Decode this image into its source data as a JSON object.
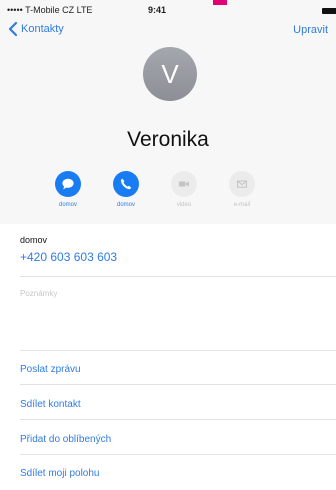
{
  "status_bar": {
    "carrier": "••••• T-Mobile CZ  LTE",
    "time": "9:41"
  },
  "nav": {
    "back_label": "Kontakty",
    "edit_label": "Upravit"
  },
  "contact": {
    "initial": "V",
    "name": "Veronika"
  },
  "actions": [
    {
      "label": "domov",
      "icon": "message-icon",
      "active": true
    },
    {
      "label": "domov",
      "icon": "phone-icon",
      "active": true
    },
    {
      "label": "video",
      "icon": "video-icon",
      "active": false
    },
    {
      "label": "e-mail",
      "icon": "mail-icon",
      "active": false
    }
  ],
  "phone": {
    "label": "domov",
    "number": "+420 603 603 603"
  },
  "notes": {
    "placeholder": "Poznámky"
  },
  "list": [
    "Poslat zprávu",
    "Sdílet kontakt",
    "Přidat do oblíbených",
    "Sdílet moji polohu"
  ],
  "colors": {
    "accent": "#2f7de1",
    "header_bg": "#f7f7f7",
    "avatar": "#979aa0",
    "carrier_pink": "#e20074"
  }
}
